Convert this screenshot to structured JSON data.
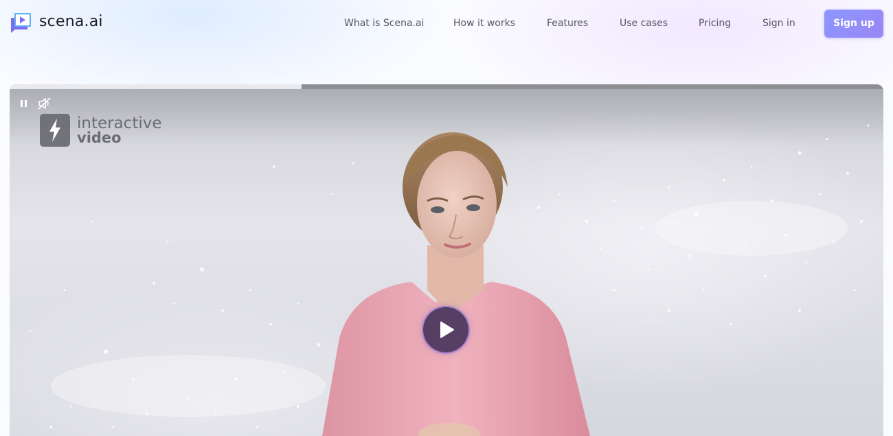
{
  "brand": {
    "name": "scena.ai",
    "logo_icon": "play-chat-logo-icon",
    "logo_colors": [
      "#7b6cf0",
      "#5fb0f5"
    ]
  },
  "nav": {
    "items": [
      {
        "label": "What is Scena.ai"
      },
      {
        "label": "How it works"
      },
      {
        "label": "Features"
      },
      {
        "label": "Use cases"
      },
      {
        "label": "Pricing"
      },
      {
        "label": "Sign in"
      }
    ],
    "signup_label": "Sign up",
    "signup_color": "#8f90fb"
  },
  "video": {
    "progress_fraction": 0.334,
    "watermark": {
      "icon": "lightning-bolt-icon",
      "line1": "interactive",
      "line2": "video"
    },
    "controls": {
      "pause_icon": "pause-icon",
      "mute_icon": "muted-speaker-icon",
      "center_play_icon": "play-icon"
    },
    "presenter": "avatar-presenter"
  }
}
